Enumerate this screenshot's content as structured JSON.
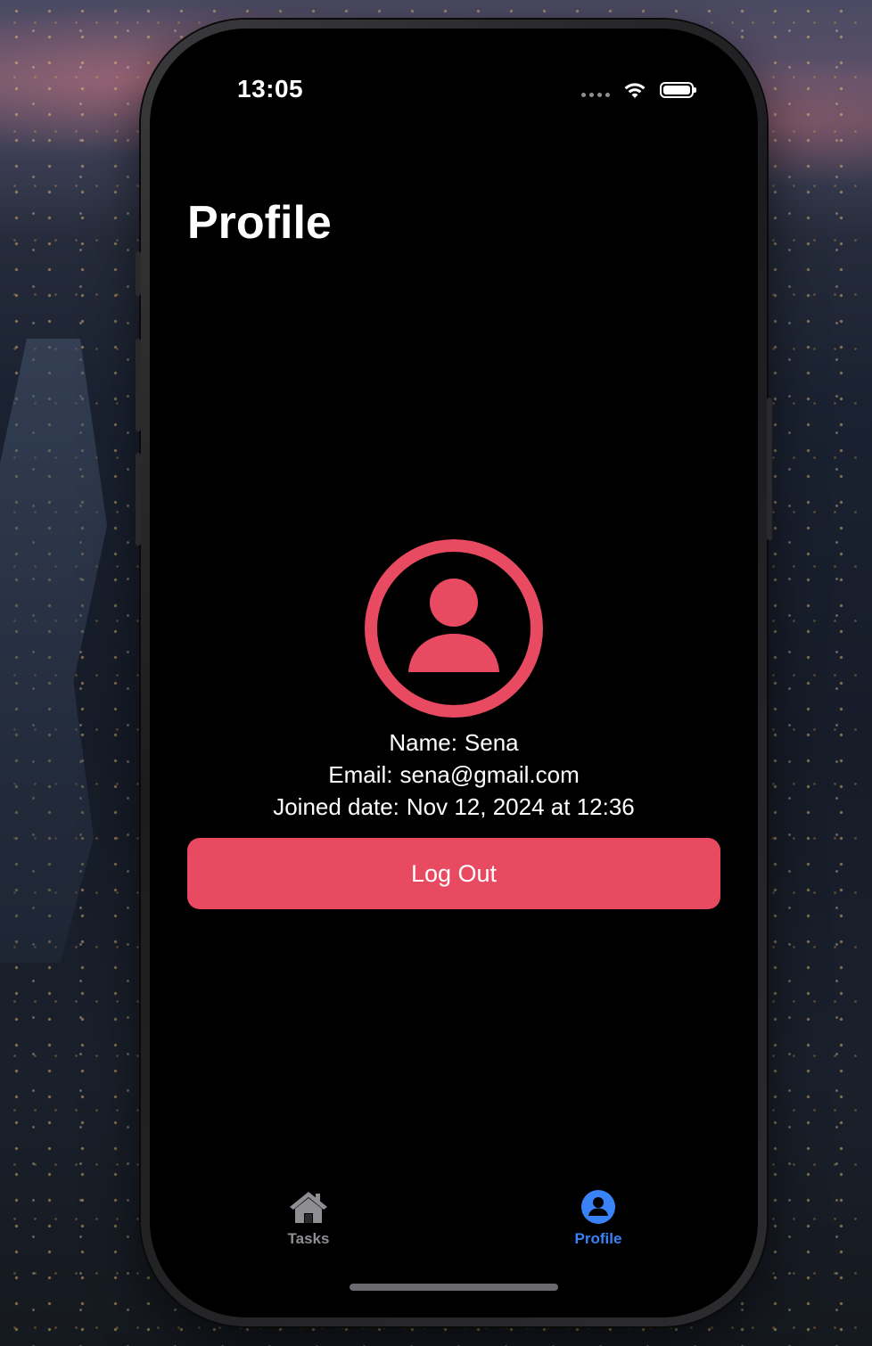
{
  "status_bar": {
    "time": "13:05"
  },
  "header": {
    "title": "Profile"
  },
  "profile": {
    "name_label": "Name:",
    "name_value": "Sena",
    "email_label": "Email:",
    "email_value": "sena@gmail.com",
    "joined_label": "Joined date:",
    "joined_value": "Nov 12, 2024 at 12:36"
  },
  "actions": {
    "logout_label": "Log Out"
  },
  "tab_bar": {
    "tasks_label": "Tasks",
    "profile_label": "Profile"
  },
  "icons": {
    "avatar": "person-circle-icon",
    "tasks": "house-icon",
    "profile": "person-circle-fill-icon",
    "wifi": "wifi-icon",
    "battery": "battery-icon",
    "signal": "cellular-signal-icon"
  },
  "colors": {
    "accent": "#e84a62",
    "tab_active": "#3a82f7",
    "tab_inactive": "#8e8e93",
    "background": "#000000"
  }
}
